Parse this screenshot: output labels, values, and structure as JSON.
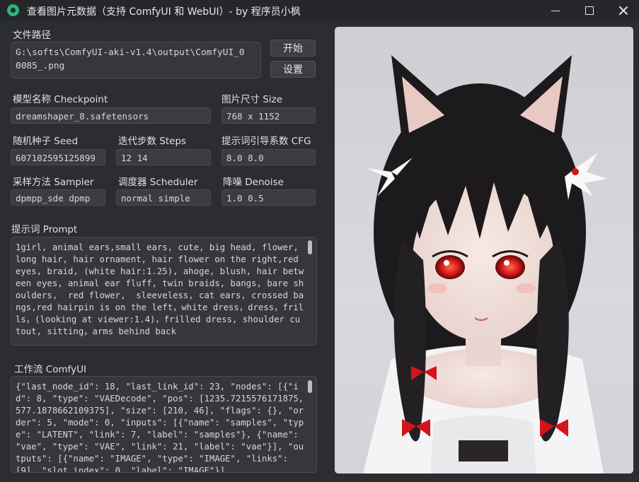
{
  "window": {
    "title": "查看图片元数据（支持 ComfyUI 和 WebUI）- by 程序员小枫"
  },
  "file_path": {
    "label": "文件路径",
    "value": "G:\\softs\\ComfyUI-aki-v1.4\\output\\ComfyUI_0\n0085_.png"
  },
  "buttons": {
    "start": "开始",
    "settings": "设置"
  },
  "fields": {
    "checkpoint": {
      "label": "模型名称 Checkpoint",
      "value": "dreamshaper_8.safetensors"
    },
    "size": {
      "label": "图片尺寸 Size",
      "value": "768 x 1152"
    },
    "seed": {
      "label": "随机种子 Seed",
      "value": "607102595125899"
    },
    "steps": {
      "label": "迭代步数 Steps",
      "value": "12  14"
    },
    "cfg": {
      "label": "提示词引导系数 CFG",
      "value": "8.0  8.0"
    },
    "sampler": {
      "label": "采样方法 Sampler",
      "value": "dpmpp_sde  dpmp"
    },
    "scheduler": {
      "label": "调度器 Scheduler",
      "value": "normal  simple"
    },
    "denoise": {
      "label": "降噪 Denoise",
      "value": "1.0  0.5"
    }
  },
  "prompt": {
    "label": "提示词 Prompt",
    "value": "1girl, animal ears,small ears, cute, big head, flower, long hair, hair ornament, hair flower on the right,red eyes, braid, (white hair:1.25), ahoge, blush, hair between eyes, animal ear fluff, twin braids, bangs, bare shoulders,  red flower,  sleeveless, cat ears, crossed bangs,red hairpin is on the left，white dress，dress，frills，(looking at viewer:1.4)，frilled dress, shoulder cutout, sitting，arms behind back"
  },
  "workflow": {
    "label": "工作流 ComfyUI",
    "value": "{\"last_node_id\": 18, \"last_link_id\": 23, \"nodes\": [{\"id\": 8, \"type\": \"VAEDecode\", \"pos\": [1235.7215576171875, 577.1878662109375], \"size\": [210, 46], \"flags\": {}, \"order\": 5, \"mode\": 0, \"inputs\": [{\"name\": \"samples\", \"type\": \"LATENT\", \"link\": 7, \"label\": \"samples\"}, {\"name\": \"vae\", \"type\": \"VAE\", \"link\": 21, \"label\": \"vae\"}], \"outputs\": [{\"name\": \"IMAGE\", \"type\": \"IMAGE\", \"links\": [9], \"slot_index\": 0, \"label\": \"IMAGE\"}]"
  },
  "preview": {
    "description_icon": "image-preview"
  },
  "colors": {
    "background": "#2b2d30",
    "accent": "#2fb37a",
    "eye_red": "#d01818"
  }
}
